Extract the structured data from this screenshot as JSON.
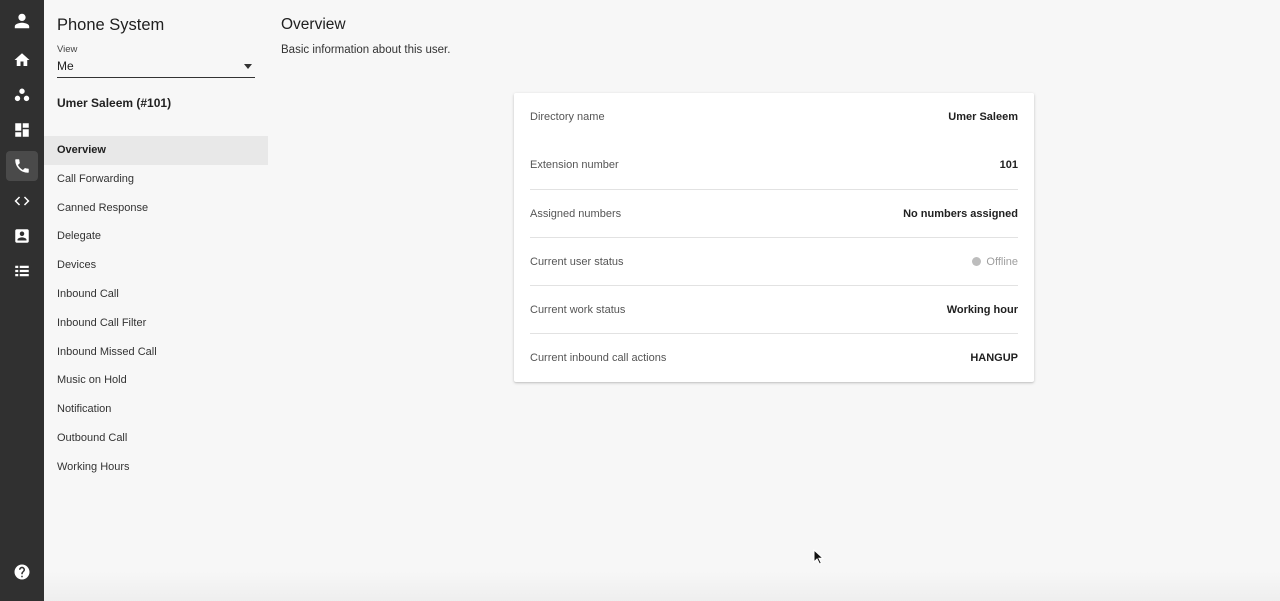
{
  "rail": {
    "items": [
      {
        "icon": "user-avatar-icon"
      },
      {
        "icon": "home-icon"
      },
      {
        "icon": "group-icon"
      },
      {
        "icon": "dashboard-icon"
      },
      {
        "icon": "phone-icon",
        "active": true
      },
      {
        "icon": "code-icon"
      },
      {
        "icon": "contact-card-icon"
      },
      {
        "icon": "list-icon"
      }
    ],
    "help_icon": "help-icon"
  },
  "sidebar": {
    "title": "Phone System",
    "view_label": "View",
    "view_value": "Me",
    "user_heading": "Umer Saleem (#101)",
    "nav": [
      {
        "label": "Overview",
        "active": true
      },
      {
        "label": "Call Forwarding"
      },
      {
        "label": "Canned Response"
      },
      {
        "label": "Delegate"
      },
      {
        "label": "Devices"
      },
      {
        "label": "Inbound Call"
      },
      {
        "label": "Inbound Call Filter"
      },
      {
        "label": "Inbound Missed Call"
      },
      {
        "label": "Music on Hold"
      },
      {
        "label": "Notification"
      },
      {
        "label": "Outbound Call"
      },
      {
        "label": "Working Hours"
      }
    ]
  },
  "main": {
    "title": "Overview",
    "subtitle": "Basic information about this user.",
    "details": [
      {
        "label": "Directory name",
        "value": "Umer Saleem"
      },
      {
        "label": "Extension number",
        "value": "101"
      },
      {
        "label": "Assigned numbers",
        "value": "No numbers assigned"
      },
      {
        "label": "Current user status",
        "value": "Offline"
      },
      {
        "label": "Current work status",
        "value": "Working hour"
      },
      {
        "label": "Current inbound call actions",
        "value": "HANGUP"
      }
    ]
  },
  "colors": {
    "rail_bg": "#303030",
    "page_bg": "#f7f7f7",
    "active_nav_bg": "#e8e8e8",
    "offline_dot": "#bdbdbd"
  }
}
